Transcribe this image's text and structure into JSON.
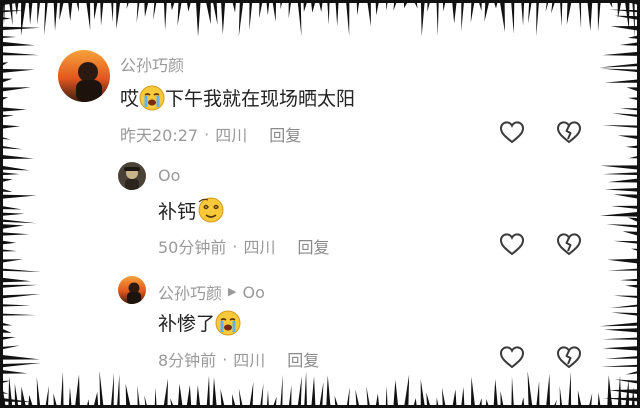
{
  "comments": [
    {
      "author": "公孙巧颜",
      "text_before": "哎",
      "text_after": "下午我就在现场晒太阳",
      "emoji": "crying-face",
      "time": "昨天20:27",
      "location": "四川",
      "reply_label": "回复"
    }
  ],
  "replies": [
    {
      "author": "Oo",
      "text": "补钙",
      "emoji": "dizzy-face",
      "time": "50分钟前",
      "location": "四川",
      "reply_label": "回复"
    },
    {
      "author": "公孙巧颜",
      "reply_to": "Oo",
      "text": "补惨了",
      "emoji": "crying-face",
      "time": "8分钟前",
      "location": "四川",
      "reply_label": "回复"
    }
  ],
  "separator": "·",
  "icons": {
    "like": "heart-outline-icon",
    "dislike": "broken-heart-icon"
  },
  "colors": {
    "meta_gray": "#9a9a9a",
    "text": "#222222",
    "frame": "#111111"
  }
}
